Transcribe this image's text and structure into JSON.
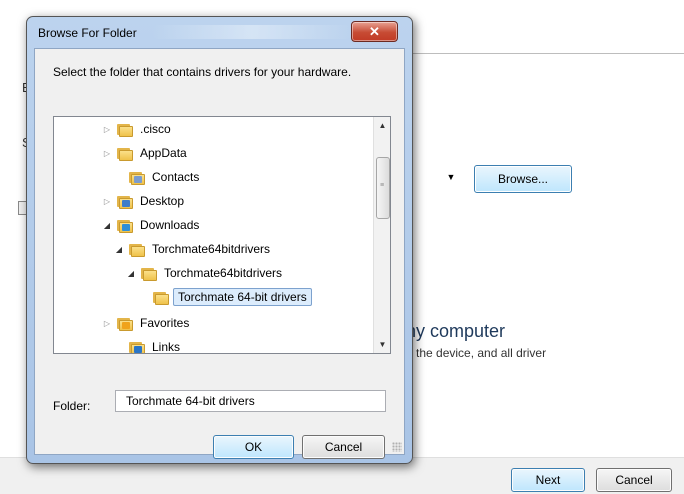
{
  "background_window": {
    "left_letters": [
      "B",
      "S"
    ],
    "combo_arrow": "▼",
    "browse_label": "Browse...",
    "option_title": "hy computer",
    "option_desc": "n the device, and all driver",
    "next_label": "Next",
    "cancel_label": "Cancel"
  },
  "dialog": {
    "title": "Browse For Folder",
    "close_glyph": "✕",
    "instruction": "Select the folder that contains drivers for your hardware.",
    "tree": [
      {
        "label": ".cisco",
        "arrow": "▷",
        "badge": ""
      },
      {
        "label": "AppData",
        "arrow": "▷",
        "badge": ""
      },
      {
        "label": "Contacts",
        "arrow": "",
        "badge": "contacts"
      },
      {
        "label": "Desktop",
        "arrow": "▷",
        "badge": "desktop"
      },
      {
        "label": "Downloads",
        "arrow": "◢",
        "badge": "downloads"
      },
      {
        "label": "Torchmate64bitdrivers",
        "arrow": "◢",
        "badge": ""
      },
      {
        "label": "Torchmate64bitdrivers",
        "arrow": "◢",
        "badge": ""
      },
      {
        "label": "Torchmate 64-bit drivers",
        "arrow": "",
        "badge": ""
      },
      {
        "label": "Favorites",
        "arrow": "▷",
        "badge": "favorites"
      },
      {
        "label": "Links",
        "arrow": "",
        "badge": "links"
      }
    ],
    "selected_index": 7,
    "folder_label": "Folder:",
    "folder_value": "Torchmate 64-bit drivers",
    "ok_label": "OK",
    "cancel_label": "Cancel"
  },
  "colors": {
    "title_bar": "#bcd3ee",
    "close_button": "#c74b34",
    "selection": "#dcecfc",
    "folder": "#efc24a",
    "background_title": "#1e395b"
  }
}
